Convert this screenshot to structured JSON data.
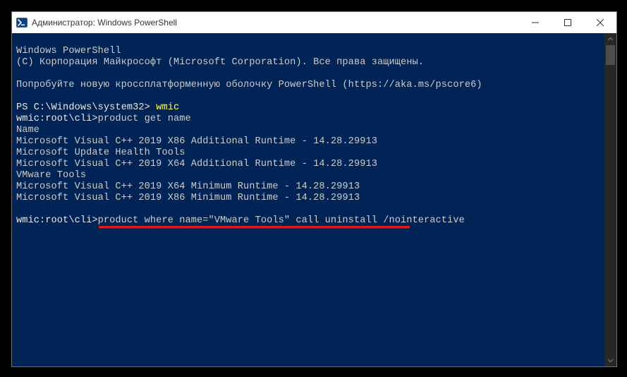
{
  "titlebar": {
    "title": "Администратор: Windows PowerShell"
  },
  "terminal": {
    "header1": "Windows PowerShell",
    "header2": "(C) Корпорация Майкрософт (Microsoft Corporation). Все права защищены.",
    "promo": "Попробуйте новую кроссплатформенную оболочку PowerShell (https://aka.ms/pscore6)",
    "prompt1_prefix": "PS C:\\Windows\\system32> ",
    "prompt1_cmd": "wmic",
    "line_wmic_prompt1": "wmic:root\\cli>",
    "line_cmd1": "product get name",
    "col_header": "Name",
    "products": [
      "Microsoft Visual C++ 2019 X86 Additional Runtime - 14.28.29913",
      "Microsoft Update Health Tools",
      "Microsoft Visual C++ 2019 X64 Additional Runtime - 14.28.29913",
      "VMware Tools",
      "Microsoft Visual C++ 2019 X64 Minimum Runtime - 14.28.29913",
      "Microsoft Visual C++ 2019 X86 Minimum Runtime - 14.28.29913"
    ],
    "line_wmic_prompt2": "wmic:root\\cli>",
    "line_cmd2": "product where name=\"VMware Tools\" call uninstall /nointeractive"
  }
}
